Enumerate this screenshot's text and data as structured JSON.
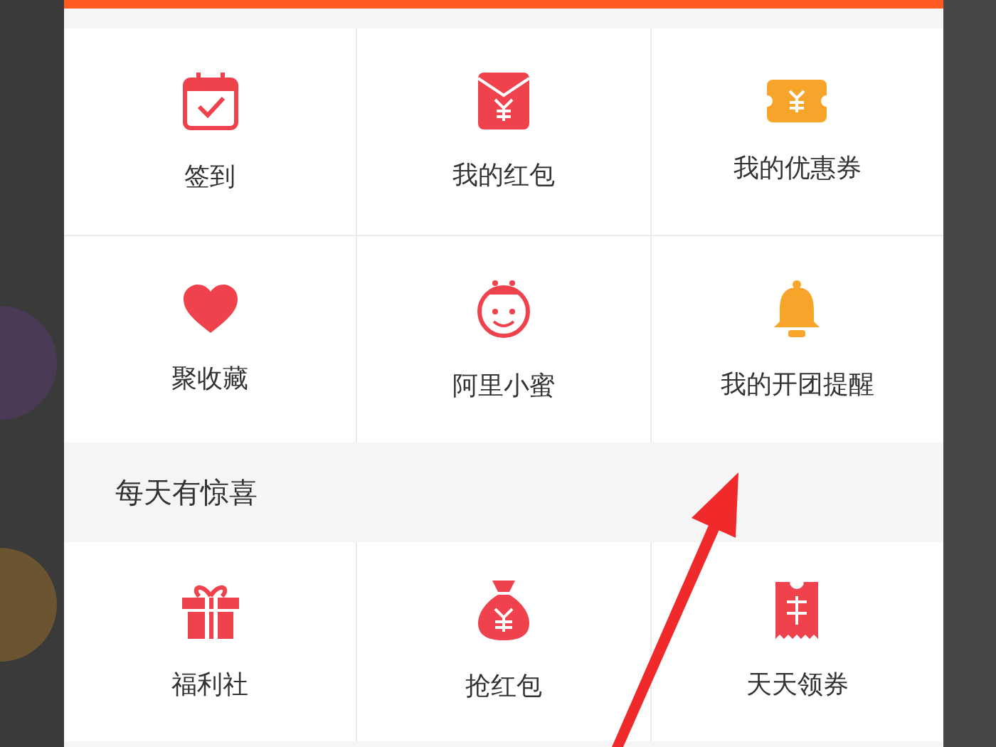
{
  "tools": [
    {
      "label": "签到"
    },
    {
      "label": "我的红包"
    },
    {
      "label": "我的优惠券"
    },
    {
      "label": "聚收藏"
    },
    {
      "label": "阿里小蜜"
    },
    {
      "label": "我的开团提醒"
    }
  ],
  "surprise": {
    "title": "每天有惊喜",
    "items": [
      {
        "label": "福利社"
      },
      {
        "label": "抢红包"
      },
      {
        "label": "天天领券"
      }
    ]
  }
}
